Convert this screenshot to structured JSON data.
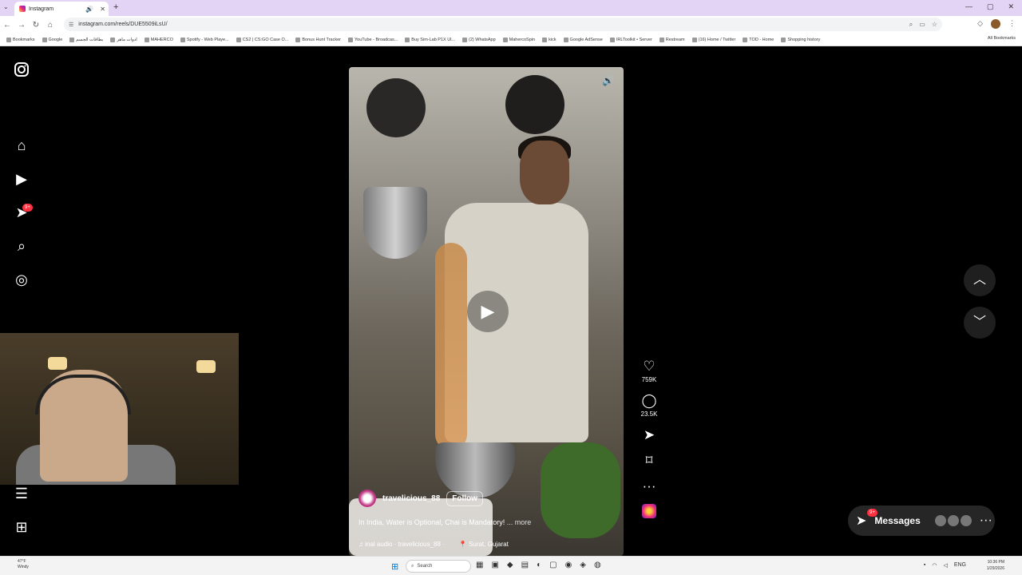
{
  "browser": {
    "tab_title": "Instagram",
    "url": "instagram.com/reels/DUE5509iLsU/",
    "new_tab": "+",
    "bookmarks": [
      "Bookmarks",
      "Google",
      "بطاقات الجسم",
      "ادوات ماهر",
      "MAHERCO",
      "Spotify - Web Playe...",
      "CS2 | CS:GO Case O...",
      "Bonus Hunt Tracker",
      "YouTube - Broadcas...",
      "Buy Sim-Lab P1X Ul...",
      "(2) WhatsApp",
      "MahercoSpin",
      "kick",
      "Google AdSense",
      "IRLToolkit • Server",
      "Restream",
      "(16) Home / Twitter",
      "TOD - Home",
      "Shopping history"
    ],
    "all_bookmarks": "All Bookmarks"
  },
  "sidebar": {
    "messages_badge": "9+"
  },
  "reel": {
    "author": "travelicious_88",
    "follow_label": "Follow",
    "caption": "In India, Water is Optional, Chai is Mandatory!",
    "more_label": "... more",
    "audio": "inal audio · travelicious_88 ·",
    "location": "Surat, Gujarat",
    "likes": "759K",
    "comments": "23.5K"
  },
  "messages": {
    "label": "Messages",
    "badge": "9+"
  },
  "taskbar": {
    "weather_temp": "47°F",
    "weather_desc": "Windy",
    "search_placeholder": "Search",
    "lang": "ENG",
    "time": "10:36 PM",
    "date": "1/29/2026"
  },
  "colors": {
    "accent_badge": "#ff3040",
    "tabbar_bg": "#e3d4f5"
  }
}
